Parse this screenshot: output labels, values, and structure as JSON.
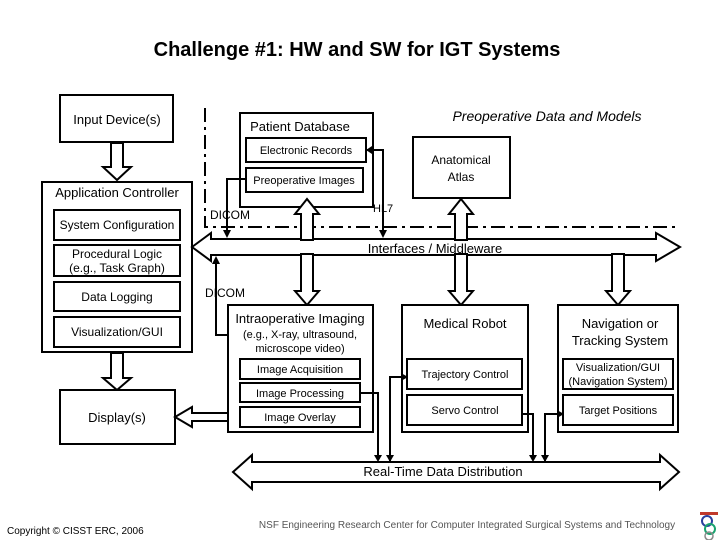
{
  "title": "Challenge #1: HW and SW for IGT Systems",
  "input_device": "Input Device(s)",
  "app_controller": {
    "title": "Application Controller",
    "items": [
      "System Configuration",
      "Procedural Logic",
      "(e.g., Task Graph)",
      "Data Logging",
      "Visualization/GUI"
    ]
  },
  "display": "Display(s)",
  "preop_section": "Preoperative Data and Models",
  "patient_db": {
    "title": "Patient Database",
    "electronic_records": "Electronic Records",
    "preop_images": "Preoperative Images"
  },
  "atlas": [
    "Anatomical",
    "Atlas"
  ],
  "labels": {
    "dicom_top": "DICOM",
    "hl7": "HL7",
    "dicom_bottom": "DICOM"
  },
  "middleware": "Interfaces / Middleware",
  "intraop": {
    "title": "Intraoperative Imaging",
    "sub": [
      "(e.g., X-ray, ultrasound,",
      "microscope video)"
    ],
    "items": [
      "Image Acquisition",
      "Image Processing",
      "Image Overlay"
    ]
  },
  "robot": {
    "title": "Medical Robot",
    "items": [
      "Trajectory Control",
      "Servo Control"
    ]
  },
  "navigation": {
    "title": [
      "Navigation or",
      "Tracking System"
    ],
    "gui": [
      "Visualization/GUI",
      "(Navigation System)"
    ],
    "target": "Target Positions"
  },
  "realtime": "Real-Time Data Distribution",
  "footer": {
    "copyright": "Copyright © CISST ERC, 2006",
    "center": "NSF Engineering Research Center for Computer Integrated Surgical Systems and Technology"
  },
  "colors": {
    "text": "#000000",
    "footer_text": "#555555",
    "logo_red": "#c0392b",
    "logo_blue": "#2a3f9e",
    "logo_green": "#1aa36f"
  }
}
